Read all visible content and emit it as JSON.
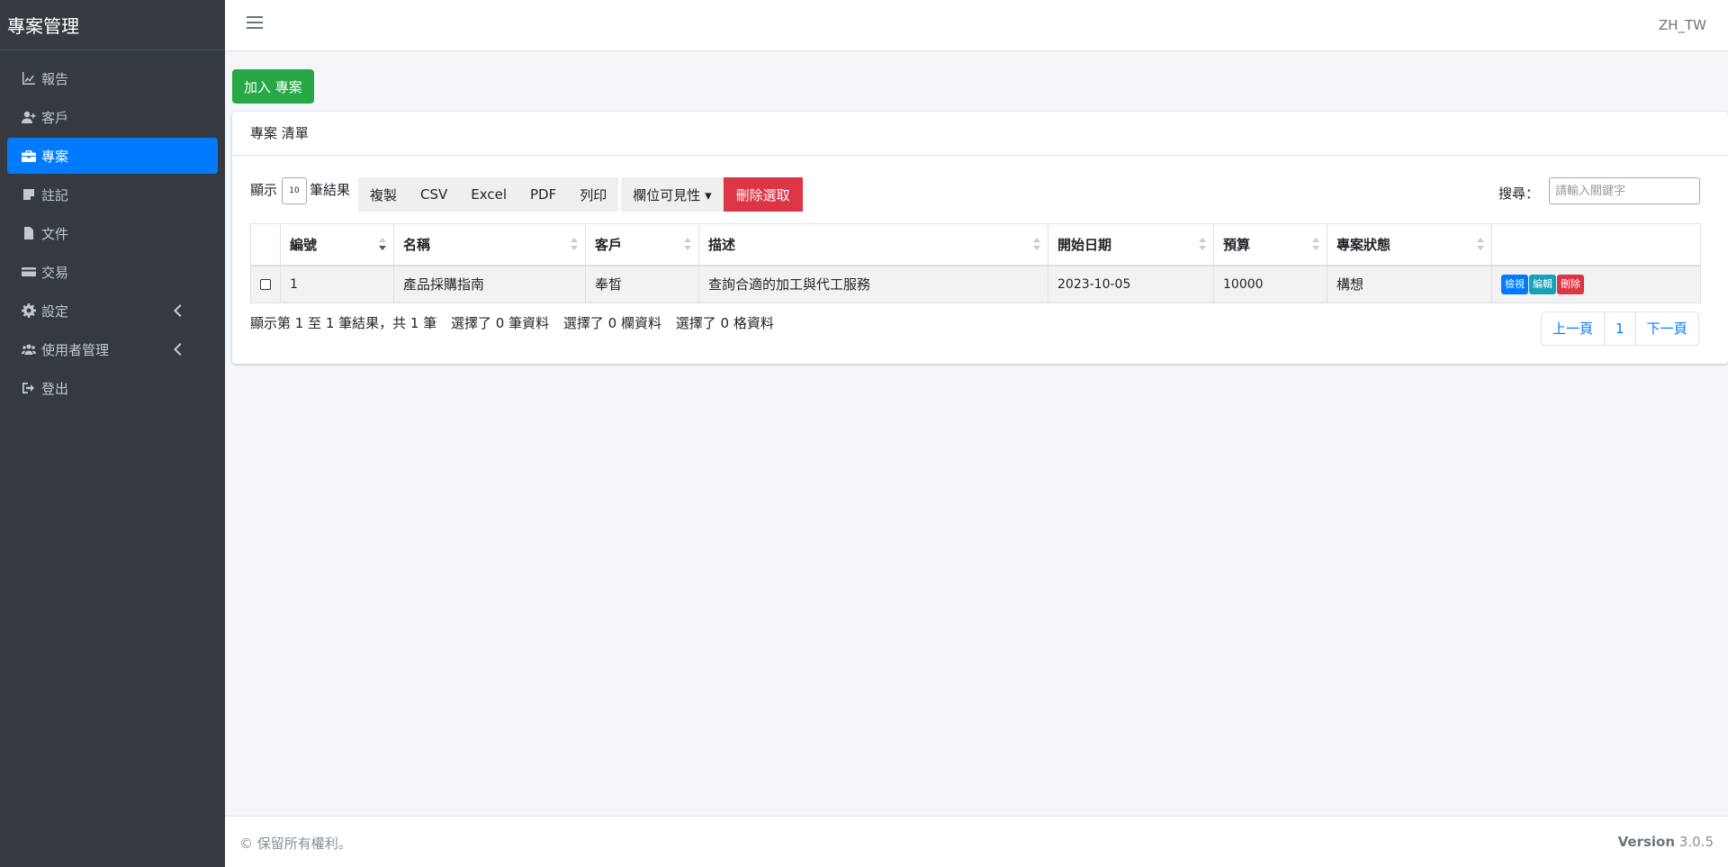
{
  "brand": "專案管理",
  "sidebar": {
    "items": [
      {
        "label": "報告"
      },
      {
        "label": "客戶"
      },
      {
        "label": "專案"
      },
      {
        "label": "註記"
      },
      {
        "label": "文件"
      },
      {
        "label": "交易"
      },
      {
        "label": "設定"
      },
      {
        "label": "使用者管理"
      },
      {
        "label": "登出"
      }
    ]
  },
  "topbar": {
    "lang": "ZH_TW"
  },
  "main": {
    "add_button": "加入 專案",
    "card_title": "專案 清單",
    "length_label": "顯示",
    "length_value": "10",
    "length_suffix": "筆結果",
    "buttons": {
      "copy": "複製",
      "csv": "CSV",
      "excel": "Excel",
      "pdf": "PDF",
      "print": "列印",
      "colvis": "欄位可見性",
      "delete": "刪除選取"
    },
    "search_label": "搜尋：",
    "search_placeholder": "請輸入關鍵字",
    "columns": [
      "編號",
      "名稱",
      "客戶",
      "描述",
      "開始日期",
      "預算",
      "專案狀態"
    ],
    "rows": [
      {
        "id": "1",
        "name": "產品採購指南",
        "client": "奉晳",
        "desc": "查詢合適的加工與代工服務",
        "start": "2023-10-05",
        "budget": "10000",
        "status": "構想",
        "view": "檢視",
        "edit": "編輯",
        "del": "刪除"
      }
    ],
    "info": "顯示第 1 至 1 筆結果，共 1 筆",
    "info_rows": "選擇了 0 筆資料",
    "info_cols": "選擇了 0 欄資料",
    "info_cells": "選擇了 0 格資料",
    "pager": {
      "prev": "上一頁",
      "page": "1",
      "next": "下一頁"
    }
  },
  "footer": {
    "copyright": "© 保留所有權利。",
    "version_label": "Version",
    "version": "3.0.5"
  },
  "colors": {
    "primary": "#007bff",
    "success": "#28a745",
    "danger": "#dc3545",
    "info": "#17a2b8",
    "sidebar_bg": "#343a40"
  }
}
